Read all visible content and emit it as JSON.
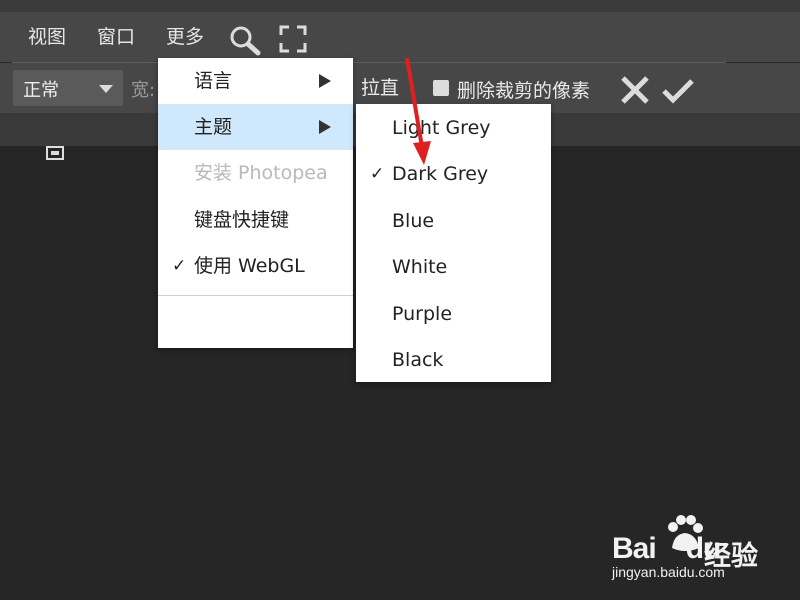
{
  "menubar": {
    "items": [
      {
        "label": "视图"
      },
      {
        "label": "窗口"
      },
      {
        "label": "更多"
      }
    ],
    "icons": [
      "search-icon",
      "fullscreen-icon"
    ]
  },
  "toolbar": {
    "mode_select": {
      "value": "正常"
    },
    "width_label": "宽:",
    "straighten_label": "拉直",
    "delete_cropped_label": "删除裁剪的像素",
    "delete_cropped_checked": false,
    "icons": [
      "cancel-icon",
      "confirm-icon"
    ]
  },
  "more_menu": {
    "items": [
      {
        "label": "语言",
        "submenu": true
      },
      {
        "label": "主题",
        "submenu": true,
        "highlighted": true
      },
      {
        "label": "安装 Photopea",
        "disabled": true
      },
      {
        "label": "键盘快捷键"
      },
      {
        "label": "使用 WebGL",
        "checked": true
      }
    ]
  },
  "theme_submenu": {
    "items": [
      {
        "label": "Light Grey"
      },
      {
        "label": "Dark Grey",
        "checked": true
      },
      {
        "label": "Blue"
      },
      {
        "label": "White"
      },
      {
        "label": "Purple"
      },
      {
        "label": "Black"
      }
    ]
  },
  "check_mark": "✓",
  "watermark": {
    "brand": "Bai",
    "brand2": "du",
    "cn": "经验",
    "url": "jingyan.baidu.com"
  },
  "colors": {
    "background": "#262626",
    "menubar": "#474747",
    "highlight": "#cfe8fb",
    "annotation_arrow": "#e02020"
  }
}
